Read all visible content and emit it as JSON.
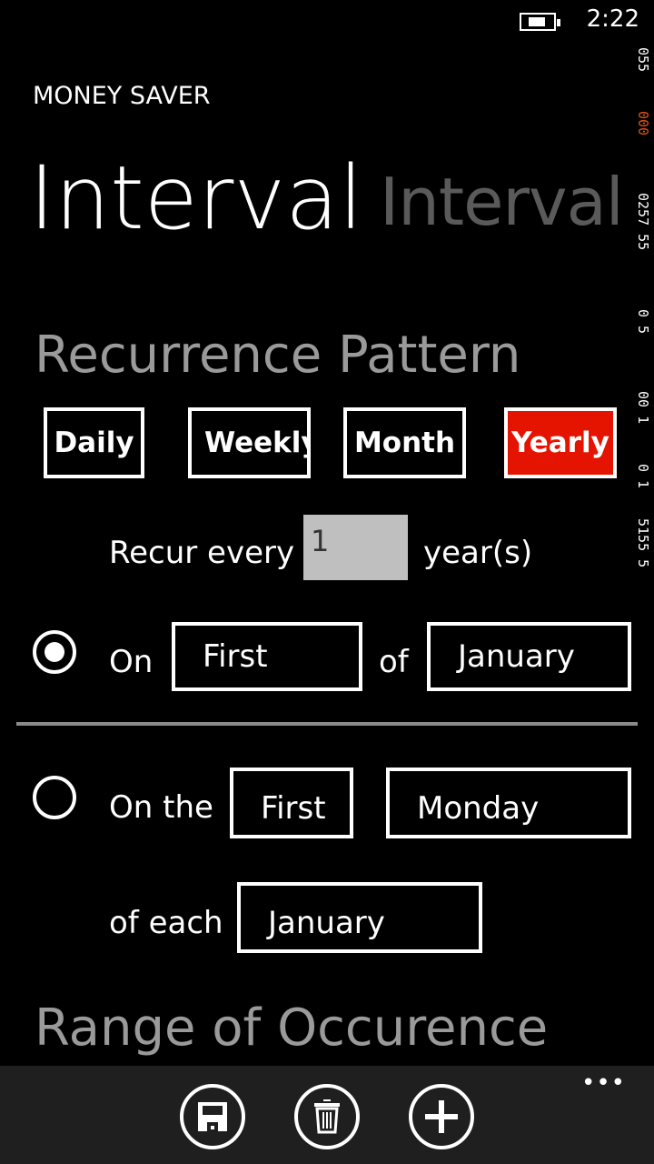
{
  "status_bar": {
    "time": "2:22",
    "battery_icon": "battery-charging-icon"
  },
  "app_title": "MONEY SAVER",
  "pivot": {
    "active": "Interval",
    "next": "Interval"
  },
  "recurrence": {
    "heading": "Recurrence Pattern",
    "types": [
      {
        "label": "Daily",
        "selected": false
      },
      {
        "label": "Weekly",
        "selected": false
      },
      {
        "label": "Month",
        "selected": false
      },
      {
        "label": "Yearly",
        "selected": true
      }
    ],
    "accent_color": "#e51400",
    "recur_every_label": "Recur every",
    "recur_every_value": "1",
    "recur_unit": "year(s)",
    "option1": {
      "selected": true,
      "on_label": "On",
      "ordinal": "First",
      "of_label": "of",
      "month": "January"
    },
    "option2": {
      "selected": false,
      "on_the_label": "On the",
      "ordinal": "First",
      "weekday": "Monday",
      "of_each_label": "of each",
      "month": "January"
    }
  },
  "range_heading": "Range of Occurence",
  "app_bar": {
    "buttons": [
      "save-icon",
      "delete-icon",
      "add-icon"
    ],
    "more": "•••"
  },
  "frame_counters": [
    "055",
    "000",
    "0257 55",
    "0 5",
    "00 1",
    "0 1",
    "5155 5"
  ]
}
